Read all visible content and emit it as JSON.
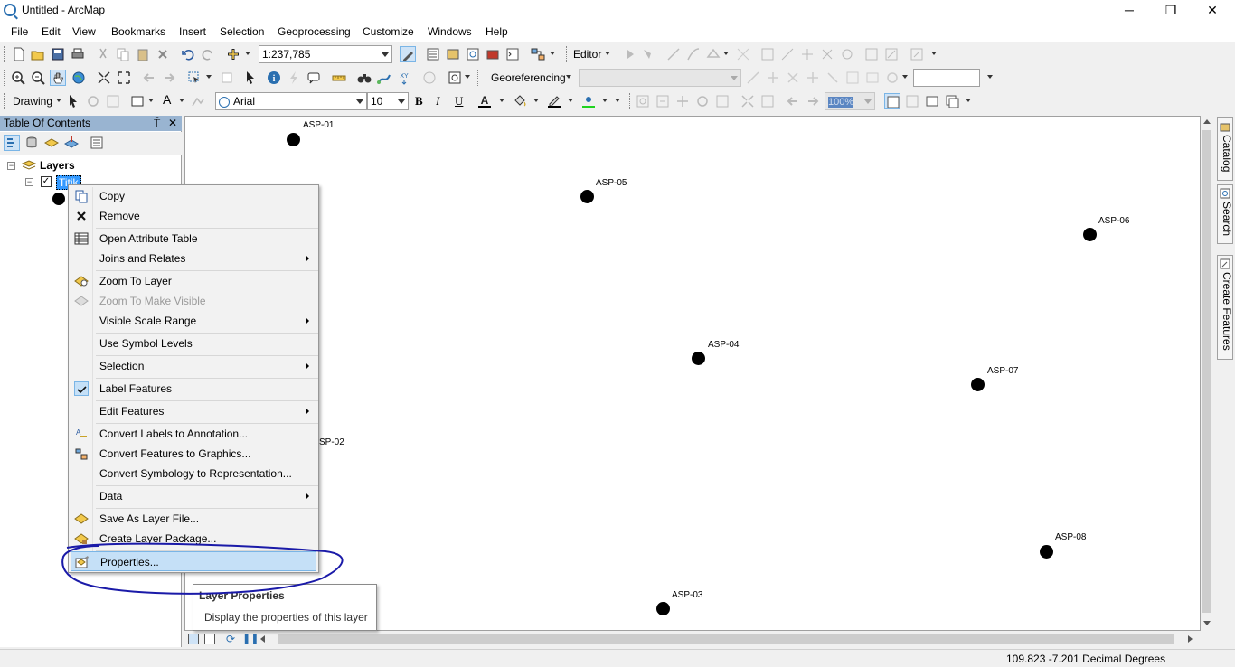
{
  "window": {
    "title": "Untitled - ArcMap",
    "minimize": "─",
    "maximize": "❐",
    "close": "✕"
  },
  "menu": [
    "File",
    "Edit",
    "View",
    "Bookmarks",
    "Insert",
    "Selection",
    "Geoprocessing",
    "Customize",
    "Windows",
    "Help"
  ],
  "toolbar": {
    "scale": "1:237,785",
    "editor_label": "Editor",
    "georef_label": "Georeferencing",
    "drawing_label": "Drawing",
    "font_name": "Arial",
    "font_size": "10",
    "bold": "B",
    "italic": "I",
    "underline": "U",
    "text_a": "A",
    "zoom_pct": "100%"
  },
  "toc": {
    "title": "Table Of Contents",
    "pin": "⍑",
    "close": "✕",
    "root_layer": "Layers",
    "layer_name": "Titik"
  },
  "map_points": [
    {
      "label": "ASP-01"
    },
    {
      "label": "ASP-05"
    },
    {
      "label": "ASP-06"
    },
    {
      "label": "ASP-04"
    },
    {
      "label": "ASP-07"
    },
    {
      "label": "SP-02"
    },
    {
      "label": "ASP-08"
    },
    {
      "label": "ASP-03"
    }
  ],
  "context_menu": {
    "copy": "Copy",
    "remove": "Remove",
    "open_attr": "Open Attribute Table",
    "joins": "Joins and Relates",
    "zoom_layer": "Zoom To Layer",
    "zoom_visible": "Zoom To Make Visible",
    "visible_scale": "Visible Scale Range",
    "use_symbol": "Use Symbol Levels",
    "selection": "Selection",
    "label_features": "Label Features",
    "edit_features": "Edit Features",
    "convert_labels": "Convert Labels to Annotation...",
    "convert_features": "Convert Features to Graphics...",
    "convert_symbology": "Convert Symbology to Representation...",
    "data": "Data",
    "save_layer": "Save As Layer File...",
    "create_package": "Create Layer Package...",
    "properties": "Properties..."
  },
  "tooltip": {
    "title": "Layer Properties",
    "body": "Display the properties of this layer"
  },
  "dock": {
    "catalog": "Catalog",
    "search": "Search",
    "create_features": "Create Features"
  },
  "status": {
    "coords": "109.823  -7.201 Decimal Degrees"
  },
  "colors": {
    "toc_header": "#99b4d1",
    "highlight": "#c5e0f7",
    "annotation": "#1a1aa8"
  }
}
